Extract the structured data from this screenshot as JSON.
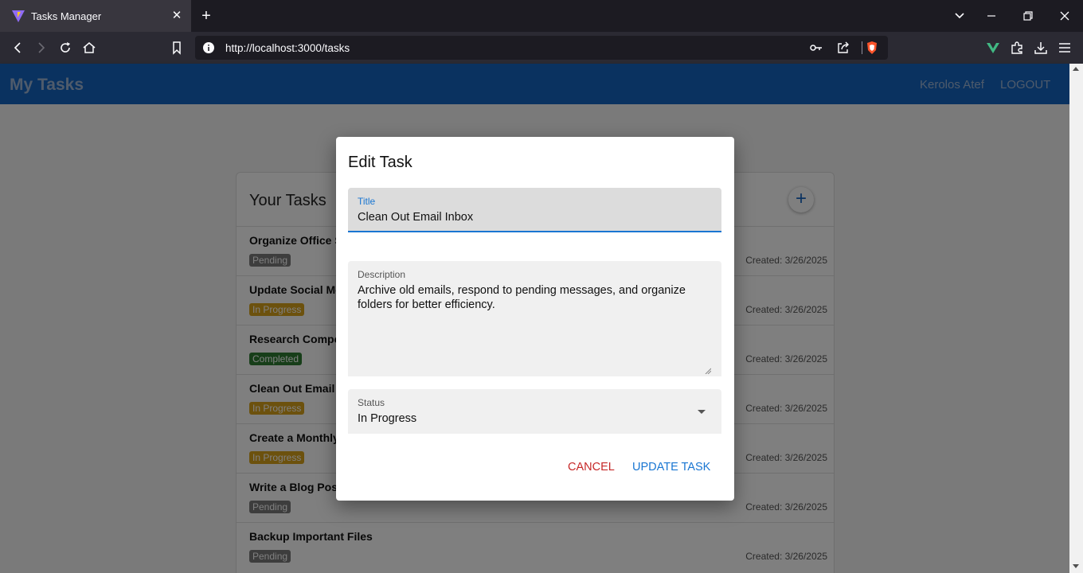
{
  "browser": {
    "tab_title": "Tasks Manager",
    "url": "http://localhost:3000/tasks"
  },
  "app": {
    "brand": "My Tasks",
    "user_name": "Kerolos Atef",
    "logout_label": "LOGOUT"
  },
  "tasks_card": {
    "title": "Your Tasks",
    "tasks": [
      {
        "title": "Organize Office S",
        "status": "Pending",
        "created": "Created: 3/26/2025"
      },
      {
        "title": "Update Social Me",
        "status": "In Progress",
        "created": "Created: 3/26/2025"
      },
      {
        "title": "Research Compe",
        "status": "Completed",
        "created": "Created: 3/26/2025"
      },
      {
        "title": "Clean Out Email I",
        "status": "In Progress",
        "created": "Created: 3/26/2025"
      },
      {
        "title": "Create a Monthly",
        "status": "In Progress",
        "created": "Created: 3/26/2025"
      },
      {
        "title": "Write a Blog Pos",
        "status": "Pending",
        "created": "Created: 3/26/2025"
      },
      {
        "title": "Backup Important Files",
        "status": "Pending",
        "created": "Created: 3/26/2025"
      }
    ]
  },
  "status_colors": {
    "Pending": "#7a7a7a",
    "In Progress": "#d9a21b",
    "Completed": "#2e7d32"
  },
  "dialog": {
    "heading": "Edit Task",
    "title_label": "Title",
    "title_value": "Clean Out Email Inbox",
    "description_label": "Description",
    "description_value": "Archive old emails, respond to pending messages, and organize folders for better efficiency.",
    "status_label": "Status",
    "status_value": "In Progress",
    "cancel_label": "CANCEL",
    "update_label": "UPDATE TASK"
  }
}
